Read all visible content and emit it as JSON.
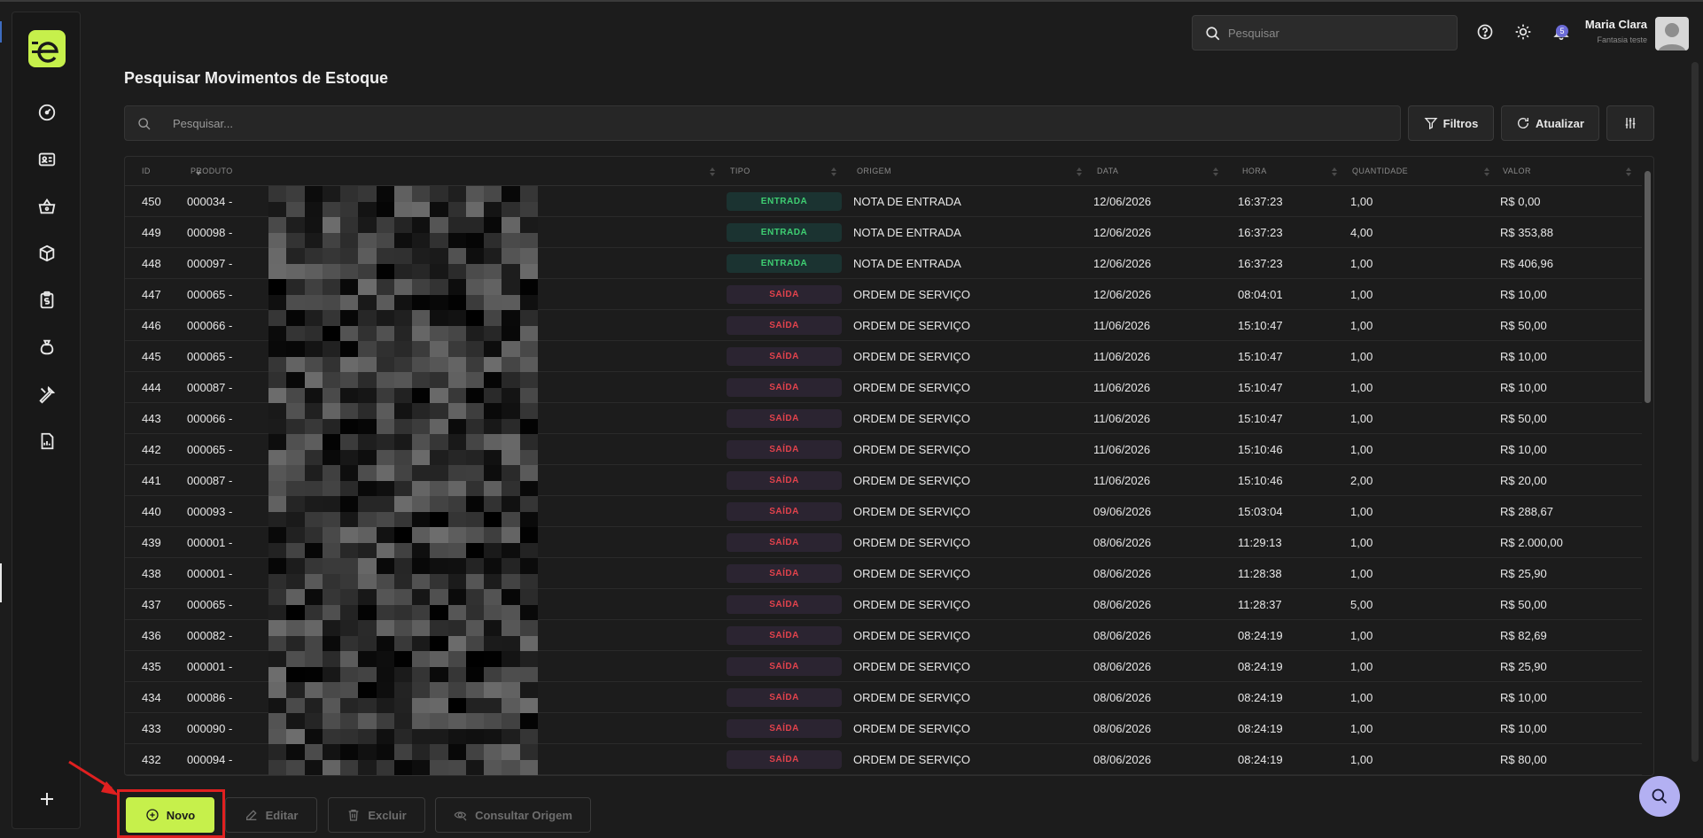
{
  "header": {
    "search_placeholder": "Pesquisar",
    "notification_count": "5",
    "user_name": "Maria Clara",
    "user_company": "Fantasia teste"
  },
  "page": {
    "title": "Pesquisar Movimentos de Estoque",
    "search_placeholder": "Pesquisar...",
    "filters_label": "Filtros",
    "refresh_label": "Atualizar"
  },
  "table": {
    "columns": [
      "ID",
      "PRODUTO",
      "TIPO",
      "ORIGEM",
      "DATA",
      "HORA",
      "QUANTIDADE",
      "VALOR"
    ],
    "rows": [
      {
        "id": "450",
        "produto": "000034 -",
        "tipo": "ENTRADA",
        "origem": "NOTA DE ENTRADA",
        "data": "12/06/2026",
        "hora": "16:37:23",
        "quantidade": "1,00",
        "valor": "R$ 0,00"
      },
      {
        "id": "449",
        "produto": "000098 -",
        "tipo": "ENTRADA",
        "origem": "NOTA DE ENTRADA",
        "data": "12/06/2026",
        "hora": "16:37:23",
        "quantidade": "4,00",
        "valor": "R$ 353,88"
      },
      {
        "id": "448",
        "produto": "000097 -",
        "tipo": "ENTRADA",
        "origem": "NOTA DE ENTRADA",
        "data": "12/06/2026",
        "hora": "16:37:23",
        "quantidade": "1,00",
        "valor": "R$ 406,96"
      },
      {
        "id": "447",
        "produto": "000065 -",
        "tipo": "SAÍDA",
        "origem": "ORDEM DE SERVIÇO",
        "data": "12/06/2026",
        "hora": "08:04:01",
        "quantidade": "1,00",
        "valor": "R$ 10,00"
      },
      {
        "id": "446",
        "produto": "000066 -",
        "tipo": "SAÍDA",
        "origem": "ORDEM DE SERVIÇO",
        "data": "11/06/2026",
        "hora": "15:10:47",
        "quantidade": "1,00",
        "valor": "R$ 50,00"
      },
      {
        "id": "445",
        "produto": "000065 -",
        "tipo": "SAÍDA",
        "origem": "ORDEM DE SERVIÇO",
        "data": "11/06/2026",
        "hora": "15:10:47",
        "quantidade": "1,00",
        "valor": "R$ 10,00"
      },
      {
        "id": "444",
        "produto": "000087 -",
        "tipo": "SAÍDA",
        "origem": "ORDEM DE SERVIÇO",
        "data": "11/06/2026",
        "hora": "15:10:47",
        "quantidade": "1,00",
        "valor": "R$ 10,00"
      },
      {
        "id": "443",
        "produto": "000066 -",
        "tipo": "SAÍDA",
        "origem": "ORDEM DE SERVIÇO",
        "data": "11/06/2026",
        "hora": "15:10:47",
        "quantidade": "1,00",
        "valor": "R$ 50,00"
      },
      {
        "id": "442",
        "produto": "000065 -",
        "tipo": "SAÍDA",
        "origem": "ORDEM DE SERVIÇO",
        "data": "11/06/2026",
        "hora": "15:10:46",
        "quantidade": "1,00",
        "valor": "R$ 10,00"
      },
      {
        "id": "441",
        "produto": "000087 -",
        "tipo": "SAÍDA",
        "origem": "ORDEM DE SERVIÇO",
        "data": "11/06/2026",
        "hora": "15:10:46",
        "quantidade": "2,00",
        "valor": "R$ 20,00"
      },
      {
        "id": "440",
        "produto": "000093 -",
        "tipo": "SAÍDA",
        "origem": "ORDEM DE SERVIÇO",
        "data": "09/06/2026",
        "hora": "15:03:04",
        "quantidade": "1,00",
        "valor": "R$ 288,67"
      },
      {
        "id": "439",
        "produto": "000001 -",
        "tipo": "SAÍDA",
        "origem": "ORDEM DE SERVIÇO",
        "data": "08/06/2026",
        "hora": "11:29:13",
        "quantidade": "1,00",
        "valor": "R$ 2.000,00"
      },
      {
        "id": "438",
        "produto": "000001 -",
        "tipo": "SAÍDA",
        "origem": "ORDEM DE SERVIÇO",
        "data": "08/06/2026",
        "hora": "11:28:38",
        "quantidade": "1,00",
        "valor": "R$ 25,90"
      },
      {
        "id": "437",
        "produto": "000065 -",
        "tipo": "SAÍDA",
        "origem": "ORDEM DE SERVIÇO",
        "data": "08/06/2026",
        "hora": "11:28:37",
        "quantidade": "5,00",
        "valor": "R$ 50,00"
      },
      {
        "id": "436",
        "produto": "000082 -",
        "tipo": "SAÍDA",
        "origem": "ORDEM DE SERVIÇO",
        "data": "08/06/2026",
        "hora": "08:24:19",
        "quantidade": "1,00",
        "valor": "R$ 82,69"
      },
      {
        "id": "435",
        "produto": "000001 -",
        "tipo": "SAÍDA",
        "origem": "ORDEM DE SERVIÇO",
        "data": "08/06/2026",
        "hora": "08:24:19",
        "quantidade": "1,00",
        "valor": "R$ 25,90"
      },
      {
        "id": "434",
        "produto": "000086 -",
        "tipo": "SAÍDA",
        "origem": "ORDEM DE SERVIÇO",
        "data": "08/06/2026",
        "hora": "08:24:19",
        "quantidade": "1,00",
        "valor": "R$ 10,00"
      },
      {
        "id": "433",
        "produto": "000090 -",
        "tipo": "SAÍDA",
        "origem": "ORDEM DE SERVIÇO",
        "data": "08/06/2026",
        "hora": "08:24:19",
        "quantidade": "1,00",
        "valor": "R$ 10,00"
      },
      {
        "id": "432",
        "produto": "000094 -",
        "tipo": "SAÍDA",
        "origem": "ORDEM DE SERVIÇO",
        "data": "08/06/2026",
        "hora": "08:24:19",
        "quantidade": "1,00",
        "valor": "R$ 80,00"
      }
    ]
  },
  "actions": {
    "new_label": "Novo",
    "edit_label": "Editar",
    "delete_label": "Excluir",
    "origin_label": "Consultar Origem"
  },
  "colors": {
    "accent": "#c6f04b",
    "entrada_text": "#3ecf72",
    "saida_text": "#e2424c",
    "highlight": "#e02020",
    "fab": "#b3b0f2"
  },
  "icons": {
    "sidebar": [
      "dashboard-icon",
      "contacts-card-icon",
      "shopping-basket-icon",
      "box-icon",
      "clipboard-dollar-icon",
      "money-bag-icon",
      "wrench-icon",
      "report-icon"
    ]
  }
}
